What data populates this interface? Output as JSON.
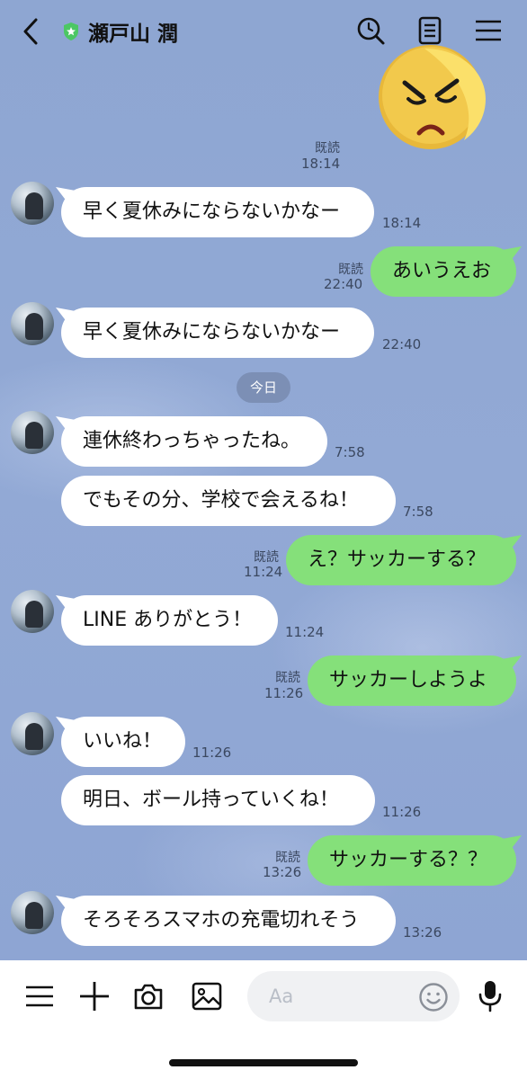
{
  "header": {
    "title": "瀬戸山 潤",
    "back_icon": "chevron-left-icon",
    "badge_icon": "official-star-badge-icon",
    "actions": [
      "search-icon",
      "notes-icon",
      "menu-icon"
    ]
  },
  "chat": {
    "sticker": {
      "read": "既読",
      "time": "18:14"
    },
    "messages": [
      {
        "text": "早く夏休みにならないかなー",
        "time": "18:14"
      },
      {
        "text": "あいうえお",
        "read": "既読",
        "time": "22:40"
      },
      {
        "text": "早く夏休みにならないかなー",
        "time": "22:40"
      },
      {
        "text": "連休終わっちゃったね。",
        "time": "7:58"
      },
      {
        "text": "でもその分、学校で会えるね！",
        "time": "7:58"
      },
      {
        "text": "え？サッカーする？",
        "read": "既読",
        "time": "11:24"
      },
      {
        "text": "LINE ありがとう！",
        "time": "11:24"
      },
      {
        "text": "サッカーしようよ",
        "read": "既読",
        "time": "11:26"
      },
      {
        "text": "いいね！",
        "time": "11:26"
      },
      {
        "text": "明日、ボール持っていくね！",
        "time": "11:26"
      },
      {
        "text": "サッカーする？？",
        "read": "既読",
        "time": "13:26"
      },
      {
        "text": "そろそろスマホの充電切れそう",
        "time": "13:26"
      }
    ],
    "date_separator": "今日"
  },
  "composer": {
    "placeholder": "Aa",
    "icons": [
      "menu-icon",
      "plus-icon",
      "camera-icon",
      "image-icon",
      "emoji-icon",
      "microphone-icon"
    ]
  },
  "colors": {
    "background": "#8fa7d4",
    "incoming_bubble": "#ffffff",
    "outgoing_bubble": "#85e07a",
    "accent_green": "#4cc764"
  }
}
